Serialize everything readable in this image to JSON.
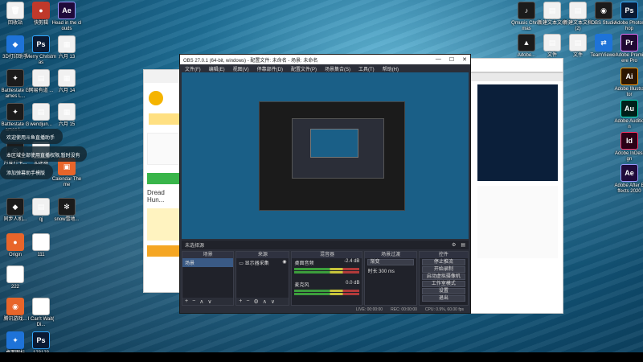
{
  "desktop_left": [
    {
      "name": "recycle-bin",
      "label": "回收站",
      "cls": "doc",
      "glyph": "🗑"
    },
    {
      "name": "kuaizhan",
      "label": "快剪辑",
      "cls": "redc",
      "glyph": "●"
    },
    {
      "name": "ae-head",
      "label": "Head in the clouds",
      "cls": "ae",
      "glyph": "Ae"
    },
    {
      "name": "3d-app",
      "label": "3D打印助手",
      "cls": "blue",
      "glyph": "◆"
    },
    {
      "name": "ps-merry",
      "label": "Merry Christmas",
      "cls": "ps",
      "glyph": "Ps"
    },
    {
      "name": "liuyue-13",
      "label": "六月 13",
      "cls": "doc",
      "glyph": "▦"
    },
    {
      "name": "battlestate",
      "label": "Battlestate Games L...",
      "cls": "dark",
      "glyph": "✦"
    },
    {
      "name": "wangyi",
      "label": "网易有道 ...",
      "cls": "doc",
      "glyph": "▤"
    },
    {
      "name": "liuyue-14",
      "label": "六月 14",
      "cls": "doc",
      "glyph": "▦"
    },
    {
      "name": "battle2",
      "label": "Battlestate Games L...",
      "cls": "dark",
      "glyph": "✦"
    },
    {
      "name": "wendjun",
      "label": "wendjun...",
      "cls": "doc",
      "glyph": "▤"
    },
    {
      "name": "liuyue-15",
      "label": "六月 15",
      "cls": "doc",
      "glyph": "▦"
    },
    {
      "name": "yuelei",
      "label": "月度打卡...",
      "cls": "dark",
      "glyph": "◎"
    },
    {
      "name": "app-green",
      "label": "加速器",
      "cls": "doc",
      "glyph": "▦"
    },
    {
      "name": "calendar",
      "label": "Calendar Theme",
      "cls": "orange",
      "glyph": "▣"
    },
    {
      "name": "jingshi",
      "label": "同步人机...",
      "cls": "dark",
      "glyph": "◆"
    },
    {
      "name": "qj",
      "label": "qj",
      "cls": "doc",
      "glyph": "▤"
    },
    {
      "name": "snow",
      "label": "snow雪地...",
      "cls": "dark",
      "glyph": "✻"
    },
    {
      "name": "origin",
      "label": "Origin",
      "cls": "orange",
      "glyph": "●"
    },
    {
      "name": "mp3-111",
      "label": "111",
      "cls": "mp3",
      "glyph": "MP3"
    },
    {
      "name": "mp3-222",
      "label": "222",
      "cls": "mp3",
      "glyph": "MP3"
    },
    {
      "name": "steam",
      "label": "腾讯游戏...",
      "cls": "orange",
      "glyph": "◉"
    },
    {
      "name": "mp3-cant",
      "label": "I Can't Wait( Di...",
      "cls": "mp3",
      "glyph": "MP3"
    },
    {
      "name": "ps-123",
      "label": "123123",
      "cls": "ps",
      "glyph": "Ps"
    },
    {
      "name": "win-app",
      "label": "桌面图标",
      "cls": "blue",
      "glyph": "✦"
    }
  ],
  "desktop_right": [
    {
      "name": "qq-music",
      "label": "Qmusic Christmas",
      "cls": "dark",
      "glyph": "♪"
    },
    {
      "name": "new-doc-1",
      "label": "新建文本文档",
      "cls": "doc",
      "glyph": "▤"
    },
    {
      "name": "new-doc-2",
      "label": "新建文本文档(2)",
      "cls": "doc",
      "glyph": "▤"
    },
    {
      "name": "obs-studio",
      "label": "OBS Studio",
      "cls": "dark",
      "glyph": "◉"
    },
    {
      "name": "ps-right",
      "label": "Adobe Photoshop",
      "cls": "ps",
      "glyph": "Ps"
    },
    {
      "name": "adobe-right",
      "label": "Adobe...",
      "cls": "dark",
      "glyph": "▲"
    },
    {
      "name": "file-a",
      "label": "文件",
      "cls": "doc",
      "glyph": "▤"
    },
    {
      "name": "file-b",
      "label": "文件",
      "cls": "doc",
      "glyph": "▤"
    },
    {
      "name": "teamviewer",
      "label": "TeamViewer",
      "cls": "blue",
      "glyph": "⇄"
    },
    {
      "name": "pr-right",
      "label": "Adobe Premiere Pro",
      "cls": "pr",
      "glyph": "Pr"
    },
    {
      "name": "ai-right",
      "label": "Adobe Illustrator",
      "cls": "ai",
      "glyph": "Ai"
    },
    {
      "name": "au-right",
      "label": "Adobe Audition",
      "cls": "au",
      "glyph": "Au"
    },
    {
      "name": "id-right",
      "label": "Adobe InDesign",
      "cls": "id",
      "glyph": "Id"
    },
    {
      "name": "ae-right",
      "label": "Adobe After Effects 2020",
      "cls": "ae",
      "glyph": "Ae"
    }
  ],
  "toasts": [
    "欢迎使用斗鱼直播助手",
    "本区域全部使用直播权限,暂时没有",
    "添加弹幕助手模版"
  ],
  "obs": {
    "title": "OBS 27.0.1 (64-bit, windows) - 配置文件: 未命名 - 场景: 未命名",
    "menu": [
      "文件(F)",
      "编辑(E)",
      "视图(V)",
      "停靠部件(D)",
      "配置文件(P)",
      "场景集合(S)",
      "工具(T)",
      "帮助(H)"
    ],
    "no_source": "未选择源",
    "docks": {
      "scenes": {
        "header": "场景",
        "items": [
          "场景"
        ]
      },
      "sources": {
        "header": "来源",
        "items": [
          "显示器采集"
        ]
      },
      "mixer": {
        "header": "混音器",
        "channels": [
          {
            "name": "桌面音频",
            "db": "-2.4 dB"
          },
          {
            "name": "麦克风",
            "db": "0.0 dB"
          }
        ]
      },
      "transitions": {
        "header": "场景过渡",
        "type": "渐变",
        "duration_label": "时长",
        "duration": "300 ms"
      },
      "controls": {
        "header": "控件",
        "buttons": [
          "停止推流",
          "开始录制",
          "启动虚拟摄像机",
          "工作室模式",
          "设置",
          "退出"
        ]
      }
    },
    "status": {
      "live": "LIVE: 00:00:00",
      "rec": "REC: 00:00:00",
      "cpu": "CPU: 0.9%, 60.00 fps"
    }
  },
  "browser_text": [
    "Dread Hun..."
  ]
}
